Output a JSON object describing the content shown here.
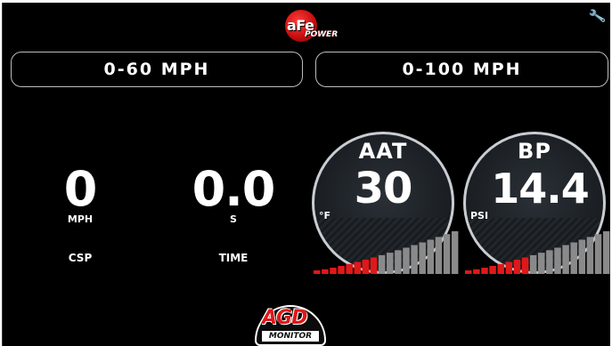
{
  "header": {
    "brand_logo": {
      "icon": "afe-power-logo",
      "text_main": "aFe",
      "text_sub": "POWER"
    },
    "settings_icon": "wrench-icon"
  },
  "timers": {
    "zero_to_sixty_label": "0-60 MPH",
    "zero_to_hundred_label": "0-100 MPH"
  },
  "readouts": {
    "speed": {
      "value": "0",
      "unit": "MPH",
      "label": "CSP"
    },
    "time": {
      "value": "0.0",
      "unit": "S",
      "label": "TIME"
    }
  },
  "gauges": {
    "aat": {
      "title": "AAT",
      "value": "30",
      "unit": "°F",
      "level_bars_total": 18,
      "level_bars_red": 8
    },
    "bp": {
      "title": "BP",
      "value": "14.4",
      "unit": "PSI",
      "level_bars_total": 18,
      "level_bars_red": 8
    }
  },
  "footer": {
    "monitor_logo": {
      "text_main": "AGD",
      "text_sub": "MONITOR"
    }
  },
  "colors": {
    "background": "#000000",
    "accent_red": "#e01818",
    "bar_gray": "#8a8a8a",
    "text": "#ffffff"
  }
}
